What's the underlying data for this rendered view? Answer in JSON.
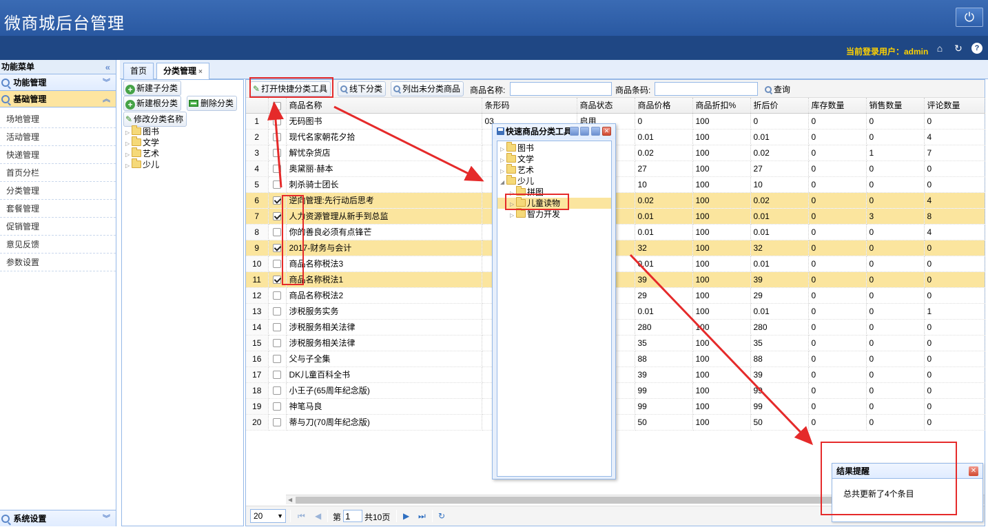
{
  "header": {
    "title": "微商城后台管理",
    "current_user_label": "当前登录用户：admin"
  },
  "sidebar": {
    "title": "功能菜单",
    "groups": [
      {
        "label": "功能管理"
      },
      {
        "label": "基础管理"
      }
    ],
    "items": [
      "场地管理",
      "活动管理",
      "快递管理",
      "首页分栏",
      "分类管理",
      "套餐管理",
      "促销管理",
      "意见反馈",
      "参数设置"
    ],
    "bottom_group": "系统设置"
  },
  "tabs": [
    {
      "label": "首页"
    },
    {
      "label": "分类管理"
    }
  ],
  "left_tree": {
    "buttons": {
      "new_child": "新建子分类",
      "new_root": "新建根分类",
      "delete": "删除分类",
      "rename": "修改分类名称"
    },
    "nodes": [
      "图书",
      "文学",
      "艺术",
      "少儿"
    ]
  },
  "toolbar": {
    "open_quick_tool": "打开快捷分类工具",
    "offline_category": "线下分类",
    "list_uncategorized": "列出未分类商品",
    "product_name_label": "商品名称:",
    "product_name_value": "",
    "barcode_label": "商品条码:",
    "barcode_value": "",
    "search": "查询"
  },
  "grid": {
    "columns": [
      "商品名称",
      "条形码",
      "商品状态",
      "商品价格",
      "商品折扣%",
      "折后价",
      "库存数量",
      "销售数量",
      "评论数量"
    ],
    "rows": [
      {
        "n": "1",
        "checked": false,
        "name": "无码图书",
        "barcode": "03",
        "status": "启用",
        "price": "0",
        "discount": "100",
        "final": "0",
        "stock": "0",
        "sold": "0",
        "comments": "0"
      },
      {
        "n": "2",
        "checked": false,
        "name": "现代名家朝花夕拾",
        "barcode": "",
        "status": "",
        "price": "0.01",
        "discount": "100",
        "final": "0.01",
        "stock": "0",
        "sold": "0",
        "comments": "4"
      },
      {
        "n": "3",
        "checked": false,
        "name": "解忧杂货店",
        "barcode": "",
        "status": "",
        "price": "0.02",
        "discount": "100",
        "final": "0.02",
        "stock": "0",
        "sold": "1",
        "comments": "7"
      },
      {
        "n": "4",
        "checked": false,
        "name": "奥黛丽·赫本",
        "barcode": "",
        "status": "",
        "price": "27",
        "discount": "100",
        "final": "27",
        "stock": "0",
        "sold": "0",
        "comments": "0"
      },
      {
        "n": "5",
        "checked": false,
        "name": "刺杀骑士团长",
        "barcode": "",
        "status": "",
        "price": "10",
        "discount": "100",
        "final": "10",
        "stock": "0",
        "sold": "0",
        "comments": "0"
      },
      {
        "n": "6",
        "checked": true,
        "name": "逆向管理:先行动后思考",
        "barcode": "",
        "status": "",
        "price": "0.02",
        "discount": "100",
        "final": "0.02",
        "stock": "0",
        "sold": "0",
        "comments": "4"
      },
      {
        "n": "7",
        "checked": true,
        "name": "人力资源管理从新手到总监",
        "barcode": "",
        "status": "",
        "price": "0.01",
        "discount": "100",
        "final": "0.01",
        "stock": "0",
        "sold": "3",
        "comments": "8"
      },
      {
        "n": "8",
        "checked": false,
        "name": "你的善良必须有点锋芒",
        "barcode": "",
        "status": "",
        "price": "0.01",
        "discount": "100",
        "final": "0.01",
        "stock": "0",
        "sold": "0",
        "comments": "4"
      },
      {
        "n": "9",
        "checked": true,
        "name": "2017-财务与会计",
        "barcode": "",
        "status": "",
        "price": "32",
        "discount": "100",
        "final": "32",
        "stock": "0",
        "sold": "0",
        "comments": "0"
      },
      {
        "n": "10",
        "checked": false,
        "name": "商品名称税法3",
        "barcode": "",
        "status": "",
        "price": "0.01",
        "discount": "100",
        "final": "0.01",
        "stock": "0",
        "sold": "0",
        "comments": "0"
      },
      {
        "n": "11",
        "checked": true,
        "name": "商品名称税法1",
        "barcode": "",
        "status": "",
        "price": "39",
        "discount": "100",
        "final": "39",
        "stock": "0",
        "sold": "0",
        "comments": "0"
      },
      {
        "n": "12",
        "checked": false,
        "name": "商品名称税法2",
        "barcode": "",
        "status": "",
        "price": "29",
        "discount": "100",
        "final": "29",
        "stock": "0",
        "sold": "0",
        "comments": "0"
      },
      {
        "n": "13",
        "checked": false,
        "name": "涉税服务实务",
        "barcode": "",
        "status": "",
        "price": "0.01",
        "discount": "100",
        "final": "0.01",
        "stock": "0",
        "sold": "0",
        "comments": "1"
      },
      {
        "n": "14",
        "checked": false,
        "name": "涉税服务相关法律",
        "barcode": "",
        "status": "",
        "price": "280",
        "discount": "100",
        "final": "280",
        "stock": "0",
        "sold": "0",
        "comments": "0"
      },
      {
        "n": "15",
        "checked": false,
        "name": "涉税服务相关法律",
        "barcode": "",
        "status": "",
        "price": "35",
        "discount": "100",
        "final": "35",
        "stock": "0",
        "sold": "0",
        "comments": "0"
      },
      {
        "n": "16",
        "checked": false,
        "name": "父与子全集",
        "barcode": "",
        "status": "",
        "price": "88",
        "discount": "100",
        "final": "88",
        "stock": "0",
        "sold": "0",
        "comments": "0"
      },
      {
        "n": "17",
        "checked": false,
        "name": "DK儿童百科全书",
        "barcode": "",
        "status": "",
        "price": "39",
        "discount": "100",
        "final": "39",
        "stock": "0",
        "sold": "0",
        "comments": "0"
      },
      {
        "n": "18",
        "checked": false,
        "name": "小王子(65周年纪念版)",
        "barcode": "",
        "status": "",
        "price": "99",
        "discount": "100",
        "final": "99",
        "stock": "0",
        "sold": "0",
        "comments": "0"
      },
      {
        "n": "19",
        "checked": false,
        "name": "神笔马良",
        "barcode": "",
        "status": "",
        "price": "99",
        "discount": "100",
        "final": "99",
        "stock": "0",
        "sold": "0",
        "comments": "0"
      },
      {
        "n": "20",
        "checked": false,
        "name": "蒂与刀(70周年纪念版)",
        "barcode": "",
        "status": "",
        "price": "50",
        "discount": "100",
        "final": "50",
        "stock": "0",
        "sold": "0",
        "comments": "0"
      }
    ]
  },
  "pager": {
    "page_size": "20",
    "page_label": "第",
    "current_page": "1",
    "total_pages": "共10页"
  },
  "quick_dialog": {
    "title": "快速商品分类工具",
    "nodes": [
      {
        "label": "图书"
      },
      {
        "label": "文学"
      },
      {
        "label": "艺术"
      },
      {
        "label": "少儿"
      },
      {
        "label": "拼图"
      },
      {
        "label": "儿童读物"
      },
      {
        "label": "智力开发"
      }
    ]
  },
  "notice": {
    "title": "结果提醒",
    "message": "总共更新了4个条目"
  },
  "colors": {
    "header_blue": "#2a5aa5",
    "highlight_row": "#fbe59e",
    "annotation_red": "#e52a2a"
  }
}
